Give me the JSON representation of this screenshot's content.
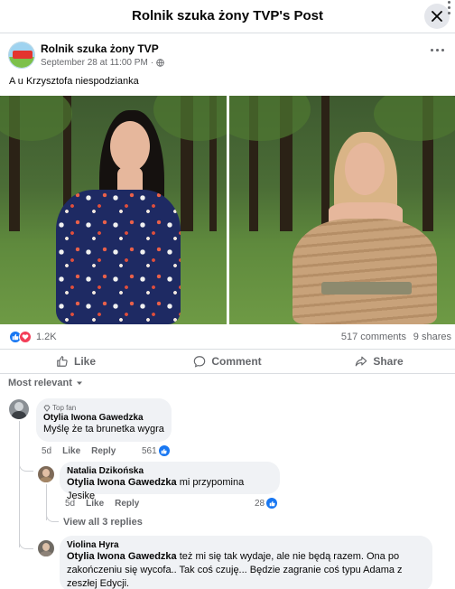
{
  "header": {
    "title": "Rolnik szuka żony TVP's Post"
  },
  "post": {
    "page_name": "Rolnik szuka żony TVP",
    "timestamp": "September 28 at 11:00 PM",
    "separator": "·",
    "text": "A u Krzysztofa niespodzianka"
  },
  "stats": {
    "reactions": "1.2K",
    "comments": "517 comments",
    "shares": "9 shares"
  },
  "actions": {
    "like": "Like",
    "comment": "Comment",
    "share": "Share"
  },
  "sort": {
    "label": "Most relevant"
  },
  "comments": [
    {
      "badge": "Top fan",
      "author": "Otylia Iwona Gawedzka",
      "text": "Myślę że ta brunetka wygra",
      "time": "5d",
      "like": "Like",
      "reply": "Reply",
      "reactions": "561"
    },
    {
      "author": "Natalia Dzikońska",
      "mention": "Otylia Iwona Gawedzka",
      "text": " mi przypomina Jesike",
      "time": "5d",
      "like": "Like",
      "reply": "Reply",
      "reactions": "28"
    },
    {
      "author": "Violina Hyra",
      "mention": "Otylia Iwona Gawedzka",
      "text": " też mi się tak wydaje, ale nie będą razem. Ona po zakończeniu się wycofa.. Tak coś czuję... Będzie zagranie coś typu Adama z zeszłej Edycji."
    }
  ],
  "view_replies": "View all 3 replies",
  "colors": {
    "facebook_blue": "#1877f2",
    "love_red": "#f33e58",
    "bubble_gray": "#f0f2f5"
  }
}
